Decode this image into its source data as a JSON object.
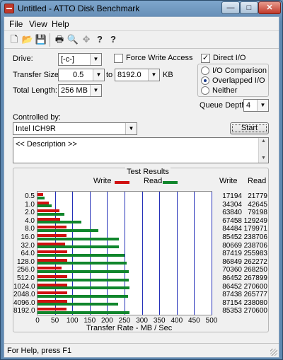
{
  "window": {
    "title": "Untitled - ATTO Disk Benchmark",
    "min_glyph": "—",
    "max_glyph": "□",
    "close_glyph": "✕"
  },
  "menu": [
    "File",
    "View",
    "Help"
  ],
  "toolbar": {
    "new_glyph": "🗋",
    "open_glyph": "📂",
    "save_glyph": "💾",
    "print_glyph": "🖶",
    "preview_glyph": "🔍",
    "move_glyph": "✥",
    "help_glyph": "?",
    "context_help_glyph": "?"
  },
  "settings": {
    "drive_label": "Drive:",
    "drive_value": "[-c-]",
    "force_write_label": "Force Write Access",
    "force_write_checked": false,
    "direct_io_label": "Direct I/O",
    "direct_io_checked": true,
    "direct_io_mark": "✓",
    "transfer_size_label": "Transfer Size:",
    "transfer_from": "0.5",
    "to_label": "to",
    "transfer_to": "8192.0",
    "transfer_unit": "KB",
    "total_length_label": "Total Length:",
    "total_length_value": "256 MB",
    "io_comparison_label": "I/O Comparison",
    "overlapped_io_label": "Overlapped I/O",
    "neither_label": "Neither",
    "io_mode_selected": "Overlapped I/O",
    "queue_depth_label": "Queue Depth:",
    "queue_depth_value": "4",
    "controlled_by_label": "Controlled by:",
    "controlled_by_value": "Intel ICH9R",
    "start_label": "Start",
    "description_text": "<< Description >>",
    "arrow_glyph": "▼"
  },
  "results": {
    "group_title": "Test Results",
    "write_legend": "Write",
    "read_legend": "Read",
    "write_color": "#d01010",
    "read_color": "#10862c",
    "col_write": "Write",
    "col_read": "Read"
  },
  "chart_data": {
    "type": "bar",
    "xlabel": "Transfer Rate - MB / Sec",
    "xlim": [
      0,
      500
    ],
    "x_ticks": [
      "0",
      "50",
      "100",
      "150",
      "200",
      "250",
      "300",
      "350",
      "400",
      "450",
      "500"
    ],
    "categories": [
      "0.5",
      "1.0",
      "2.0",
      "4.0",
      "8.0",
      "16.0",
      "32.0",
      "64.0",
      "128.0",
      "256.0",
      "512.0",
      "1024.0",
      "2048.0",
      "4096.0",
      "8192.0"
    ],
    "series": [
      {
        "name": "Write",
        "values": [
          17194,
          34304,
          63840,
          67458,
          84484,
          85452,
          80669,
          87419,
          86849,
          70360,
          86452,
          86452,
          87438,
          87154,
          85353
        ]
      },
      {
        "name": "Read",
        "values": [
          21779,
          42645,
          79198,
          129249,
          179971,
          238706,
          238706,
          255983,
          262272,
          268250,
          267899,
          270600,
          265777,
          238080,
          270600
        ]
      }
    ]
  },
  "status": {
    "text": "For Help, press F1"
  }
}
